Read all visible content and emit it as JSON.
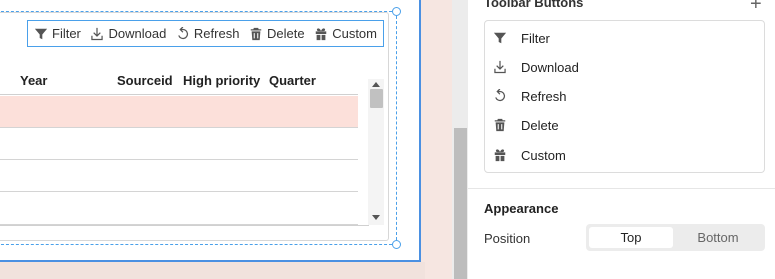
{
  "table": {
    "toolbar": {
      "filter": "Filter",
      "download": "Download",
      "refresh": "Refresh",
      "delete": "Delete",
      "custom": "Custom"
    },
    "columns": [
      "Year",
      "Sourceid",
      "High priority",
      "Quarter"
    ],
    "highlight_color": "#fce0da"
  },
  "panel": {
    "section_title": "Toolbar Buttons",
    "add_icon": "plus-icon",
    "buttons": [
      {
        "label": "Filter",
        "icon": "filter-icon"
      },
      {
        "label": "Download",
        "icon": "download-icon"
      },
      {
        "label": "Refresh",
        "icon": "refresh-icon"
      },
      {
        "label": "Delete",
        "icon": "trash-icon"
      },
      {
        "label": "Custom",
        "icon": "gift-icon"
      }
    ],
    "appearance_title": "Appearance",
    "position_label": "Position",
    "position_options": [
      "Top",
      "Bottom"
    ],
    "position_selected": "Top"
  },
  "colors": {
    "selection": "#4aa0ea",
    "canvas_bg": "#f6e6e1"
  }
}
